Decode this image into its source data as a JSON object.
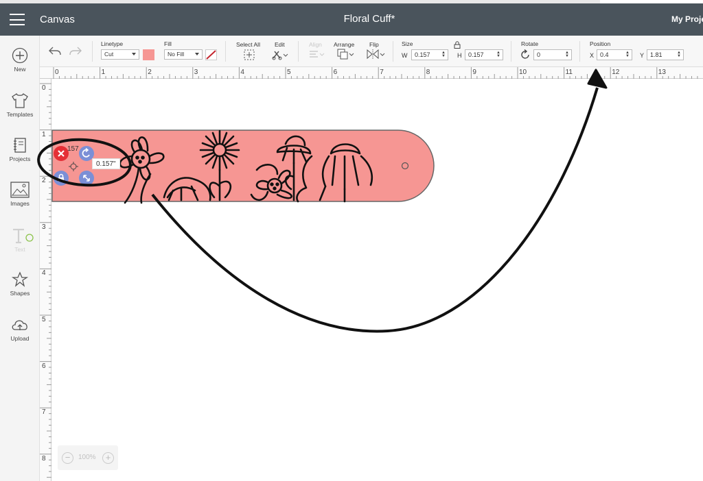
{
  "header": {
    "app_title": "Canvas",
    "project_title": "Floral Cuff*",
    "my_projects": "My Proje"
  },
  "toolbar": {
    "linetype": {
      "label": "Linetype",
      "value": "Cut"
    },
    "fill": {
      "label": "Fill",
      "value": "No Fill"
    },
    "select_all": "Select All",
    "edit": "Edit",
    "align": "Align",
    "arrange": "Arrange",
    "flip": "Flip",
    "size": {
      "label": "Size",
      "w_label": "W",
      "w_value": "0.157",
      "h_label": "H",
      "h_value": "0.157"
    },
    "rotate": {
      "label": "Rotate",
      "value": "0"
    },
    "position": {
      "label": "Position",
      "x_label": "X",
      "x_value": "0.4",
      "y_label": "Y",
      "y_value": "1.81"
    }
  },
  "sidebar": {
    "items": [
      {
        "label": "New",
        "icon": "plus-circle-icon"
      },
      {
        "label": "Templates",
        "icon": "tshirt-icon"
      },
      {
        "label": "Projects",
        "icon": "notebook-icon"
      },
      {
        "label": "Images",
        "icon": "image-icon"
      },
      {
        "label": "Text",
        "icon": "text-icon"
      },
      {
        "label": "Shapes",
        "icon": "shapes-icon"
      },
      {
        "label": "Upload",
        "icon": "cloud-upload-icon"
      }
    ]
  },
  "ruler": {
    "top": [
      "0",
      "1",
      "2",
      "3",
      "4",
      "5",
      "6",
      "7",
      "8",
      "9",
      "10",
      "11",
      "12",
      "13"
    ],
    "left": [
      "0",
      "1",
      "2",
      "3",
      "4",
      "5",
      "6",
      "7",
      "8"
    ]
  },
  "canvas": {
    "size_tooltip": "0.157\"",
    "partial_size": "157",
    "cuff_color": "#f69693"
  },
  "zoom": {
    "value": "100%"
  },
  "colors": {
    "header": "#4a545c",
    "fill_swatch": "#f69693",
    "accent_handle": "#7b8fd6",
    "delete_handle": "#e52f36"
  }
}
